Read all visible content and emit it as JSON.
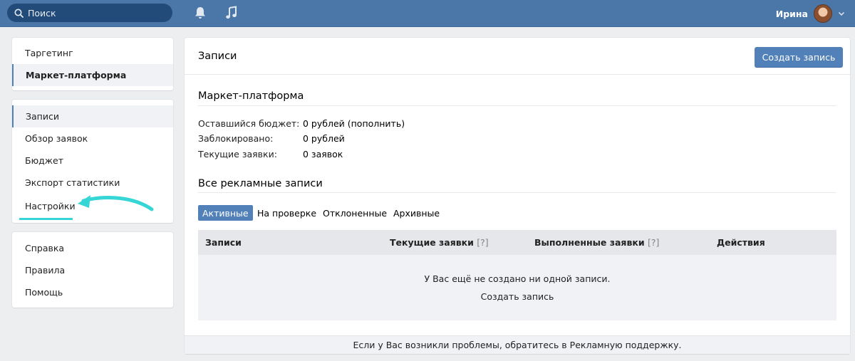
{
  "header": {
    "search_placeholder": "Поиск",
    "icons": [
      "search-icon",
      "bell-icon",
      "music-icon",
      "chevron-down-icon"
    ],
    "user_name": "Ирина"
  },
  "sidebar": {
    "group1": [
      {
        "label": "Таргетинг",
        "active": false
      },
      {
        "label": "Маркет-платформа",
        "active": true
      }
    ],
    "group2": [
      {
        "label": "Записи",
        "active": true
      },
      {
        "label": "Обзор заявок",
        "active": false
      },
      {
        "label": "Бюджет",
        "active": false
      },
      {
        "label": "Экспорт статистики",
        "active": false
      },
      {
        "label": "Настройки",
        "active": false
      }
    ],
    "group3": [
      {
        "label": "Справка"
      },
      {
        "label": "Правила"
      },
      {
        "label": "Помощь"
      }
    ]
  },
  "main": {
    "title": "Записи",
    "create_button": "Создать запись",
    "market_section_title": "Маркет-платформа",
    "stats": [
      {
        "label": "Оставшийся бюджет:",
        "value": "0 рублей (пополнить)"
      },
      {
        "label": "Заблокировано:",
        "value": "0 рублей"
      },
      {
        "label": "Текущие заявки:",
        "value": "0 заявок"
      }
    ],
    "ads_section_title": "Все рекламные записи",
    "tabs": [
      {
        "label": "Активные",
        "active": true
      },
      {
        "label": "На проверке",
        "active": false
      },
      {
        "label": "Отклоненные",
        "active": false
      },
      {
        "label": "Архивные",
        "active": false
      }
    ],
    "table": {
      "columns": [
        {
          "label": "Записи",
          "hint": ""
        },
        {
          "label": "Текущие заявки",
          "hint": "[?]"
        },
        {
          "label": "Выполненные заявки",
          "hint": "[?]"
        },
        {
          "label": "Действия",
          "hint": ""
        }
      ],
      "empty_text": "У Вас ещё не создано ни одной записи.",
      "empty_link": "Создать запись"
    }
  },
  "footer": {
    "text": "Если у Вас возникли проблемы, обратитесь в",
    "link": "Рекламную поддержку."
  },
  "colors": {
    "header_bg": "#4a76a8",
    "accent": "#5181b8",
    "annotation": "#37d6d6"
  }
}
